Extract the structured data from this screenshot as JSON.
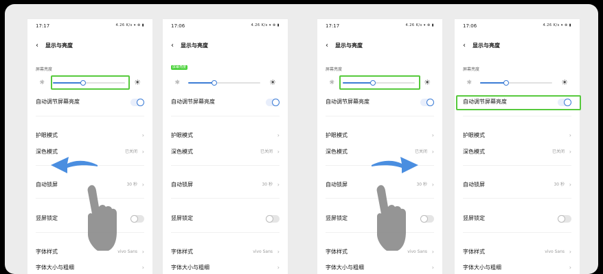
{
  "screens": [
    {
      "time": "17:17",
      "status_icons": "4.26 K/s ▾ ⊗ ▮",
      "title": "显示与亮度",
      "brightness_label": "屏幕亮度",
      "brightness_level": 0.42,
      "auto_brightness": "自动调节屏幕亮度",
      "eye_mode": "护眼模式",
      "dark_mode": "深色模式",
      "dark_mode_value": "已关闭",
      "auto_lock": "自动锁屏",
      "auto_lock_value": "30 秒",
      "portrait_lock": "竖屏锁定",
      "font_style": "字体样式",
      "font_style_value": "vivo Sans",
      "font_size": "字体大小与粗细"
    },
    {
      "time": "17:06",
      "status_icons": "4.26 K/s ▾ ⊗ ▮",
      "title": "显示与亮度",
      "brightness_label": "屏幕亮度",
      "brightness_level": 0.36,
      "auto_brightness": "自动调节屏幕亮度",
      "eye_mode": "护眼模式",
      "dark_mode": "深色模式",
      "dark_mode_value": "已关闭",
      "auto_lock": "自动锁屏",
      "auto_lock_value": "30 秒",
      "portrait_lock": "竖屏锁定",
      "font_style": "字体样式",
      "font_style_value": "vivo Sans",
      "font_size": "字体大小与粗细"
    },
    {
      "time": "17:17",
      "status_icons": "4.26 K/s ▾ ⊗ ▮",
      "title": "显示与亮度",
      "brightness_label": "屏幕亮度",
      "brightness_level": 0.42,
      "auto_brightness": "自动调节屏幕亮度",
      "eye_mode": "护眼模式",
      "dark_mode": "深色模式",
      "dark_mode_value": "已关闭",
      "auto_lock": "自动锁屏",
      "auto_lock_value": "30 秒",
      "portrait_lock": "竖屏锁定",
      "font_style": "字体样式",
      "font_style_value": "vivo Sans",
      "font_size": "字体大小与粗细"
    },
    {
      "time": "17:06",
      "status_icons": "4.26 K/s ▾ ⊗ ▮",
      "title": "显示与亮度",
      "brightness_label": "屏幕亮度",
      "brightness_level": 0.36,
      "auto_brightness": "自动调节屏幕亮度",
      "eye_mode": "护眼模式",
      "dark_mode": "深色模式",
      "dark_mode_value": "已关闭",
      "auto_lock": "自动锁屏",
      "auto_lock_value": "30 秒",
      "portrait_lock": "竖屏锁定",
      "font_style": "字体样式",
      "font_style_value": "vivo Sans",
      "font_size": "字体大小与粗细"
    }
  ],
  "colors": {
    "accent": "#3a7bd5",
    "highlight": "#56c93c",
    "arrow": "#4a8ee0",
    "hand": "#8a8a8a"
  }
}
